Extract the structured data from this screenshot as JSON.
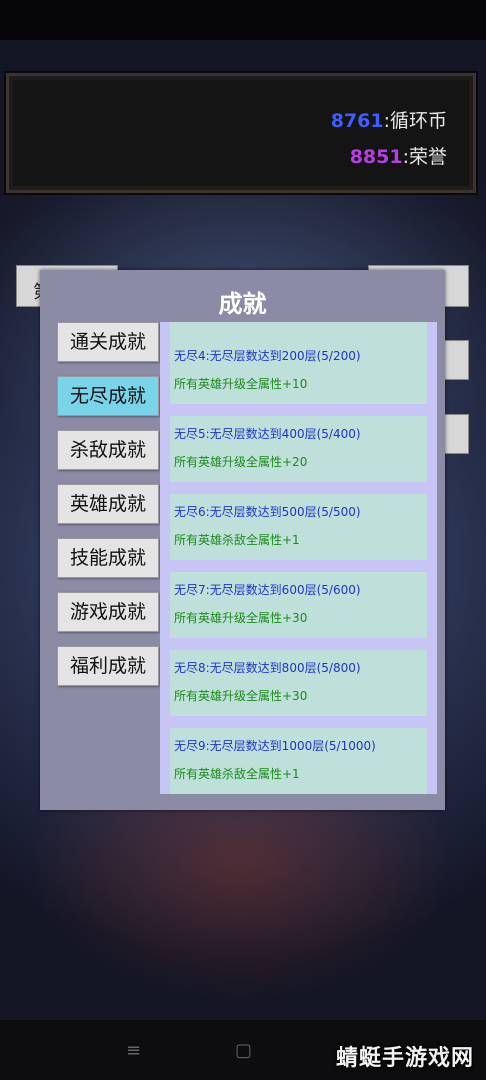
{
  "currency": {
    "coin_value": "8761",
    "coin_label": ":循环币",
    "coin_color": "#3f5cff",
    "honor_value": "8851",
    "honor_label": ":荣誉",
    "honor_color": "#b440e0"
  },
  "background_tab_text": "第",
  "modal": {
    "title": "成就",
    "tabs": [
      {
        "label": "通关成就",
        "active": false
      },
      {
        "label": "无尽成就",
        "active": true
      },
      {
        "label": "杀敌成就",
        "active": false
      },
      {
        "label": "英雄成就",
        "active": false
      },
      {
        "label": "技能成就",
        "active": false
      },
      {
        "label": "游戏成就",
        "active": false
      },
      {
        "label": "福利成就",
        "active": false
      }
    ],
    "achievements": [
      {
        "requirement": "无尽4:无尽层数达到200层(5/200)",
        "reward": "所有英雄升级全属性+10"
      },
      {
        "requirement": "无尽5:无尽层数达到400层(5/400)",
        "reward": "所有英雄升级全属性+20"
      },
      {
        "requirement": "无尽6:无尽层数达到500层(5/500)",
        "reward": "所有英雄杀敌全属性+1"
      },
      {
        "requirement": "无尽7:无尽层数达到600层(5/600)",
        "reward": "所有英雄升级全属性+30"
      },
      {
        "requirement": "无尽8:无尽层数达到800层(5/800)",
        "reward": "所有英雄升级全属性+30"
      },
      {
        "requirement": "无尽9:无尽层数达到1000层(5/1000)",
        "reward": "所有英雄杀敌全属性+1"
      }
    ]
  },
  "nav": {
    "menu_icon": "≡",
    "home_icon": "▢"
  },
  "watermark": "蜻蜓手游戏网"
}
